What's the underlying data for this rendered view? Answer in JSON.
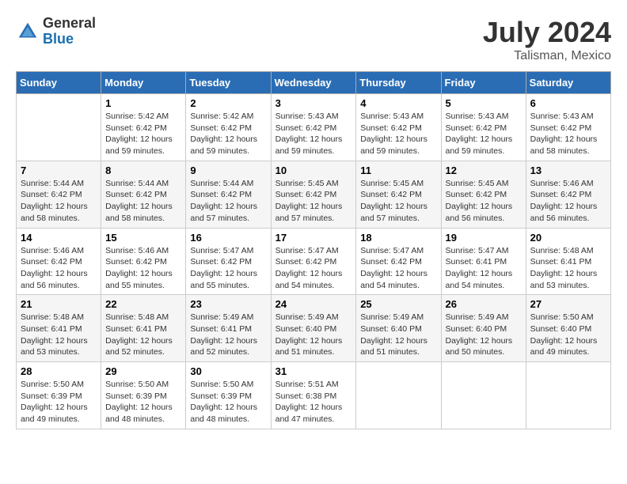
{
  "logo": {
    "general": "General",
    "blue": "Blue"
  },
  "title": {
    "month_year": "July 2024",
    "location": "Talisman, Mexico"
  },
  "days_of_week": [
    "Sunday",
    "Monday",
    "Tuesday",
    "Wednesday",
    "Thursday",
    "Friday",
    "Saturday"
  ],
  "weeks": [
    [
      {
        "day": "",
        "sunrise": "",
        "sunset": "",
        "daylight": ""
      },
      {
        "day": "1",
        "sunrise": "Sunrise: 5:42 AM",
        "sunset": "Sunset: 6:42 PM",
        "daylight": "Daylight: 12 hours and 59 minutes."
      },
      {
        "day": "2",
        "sunrise": "Sunrise: 5:42 AM",
        "sunset": "Sunset: 6:42 PM",
        "daylight": "Daylight: 12 hours and 59 minutes."
      },
      {
        "day": "3",
        "sunrise": "Sunrise: 5:43 AM",
        "sunset": "Sunset: 6:42 PM",
        "daylight": "Daylight: 12 hours and 59 minutes."
      },
      {
        "day": "4",
        "sunrise": "Sunrise: 5:43 AM",
        "sunset": "Sunset: 6:42 PM",
        "daylight": "Daylight: 12 hours and 59 minutes."
      },
      {
        "day": "5",
        "sunrise": "Sunrise: 5:43 AM",
        "sunset": "Sunset: 6:42 PM",
        "daylight": "Daylight: 12 hours and 59 minutes."
      },
      {
        "day": "6",
        "sunrise": "Sunrise: 5:43 AM",
        "sunset": "Sunset: 6:42 PM",
        "daylight": "Daylight: 12 hours and 58 minutes."
      }
    ],
    [
      {
        "day": "7",
        "sunrise": "Sunrise: 5:44 AM",
        "sunset": "Sunset: 6:42 PM",
        "daylight": "Daylight: 12 hours and 58 minutes."
      },
      {
        "day": "8",
        "sunrise": "Sunrise: 5:44 AM",
        "sunset": "Sunset: 6:42 PM",
        "daylight": "Daylight: 12 hours and 58 minutes."
      },
      {
        "day": "9",
        "sunrise": "Sunrise: 5:44 AM",
        "sunset": "Sunset: 6:42 PM",
        "daylight": "Daylight: 12 hours and 57 minutes."
      },
      {
        "day": "10",
        "sunrise": "Sunrise: 5:45 AM",
        "sunset": "Sunset: 6:42 PM",
        "daylight": "Daylight: 12 hours and 57 minutes."
      },
      {
        "day": "11",
        "sunrise": "Sunrise: 5:45 AM",
        "sunset": "Sunset: 6:42 PM",
        "daylight": "Daylight: 12 hours and 57 minutes."
      },
      {
        "day": "12",
        "sunrise": "Sunrise: 5:45 AM",
        "sunset": "Sunset: 6:42 PM",
        "daylight": "Daylight: 12 hours and 56 minutes."
      },
      {
        "day": "13",
        "sunrise": "Sunrise: 5:46 AM",
        "sunset": "Sunset: 6:42 PM",
        "daylight": "Daylight: 12 hours and 56 minutes."
      }
    ],
    [
      {
        "day": "14",
        "sunrise": "Sunrise: 5:46 AM",
        "sunset": "Sunset: 6:42 PM",
        "daylight": "Daylight: 12 hours and 56 minutes."
      },
      {
        "day": "15",
        "sunrise": "Sunrise: 5:46 AM",
        "sunset": "Sunset: 6:42 PM",
        "daylight": "Daylight: 12 hours and 55 minutes."
      },
      {
        "day": "16",
        "sunrise": "Sunrise: 5:47 AM",
        "sunset": "Sunset: 6:42 PM",
        "daylight": "Daylight: 12 hours and 55 minutes."
      },
      {
        "day": "17",
        "sunrise": "Sunrise: 5:47 AM",
        "sunset": "Sunset: 6:42 PM",
        "daylight": "Daylight: 12 hours and 54 minutes."
      },
      {
        "day": "18",
        "sunrise": "Sunrise: 5:47 AM",
        "sunset": "Sunset: 6:42 PM",
        "daylight": "Daylight: 12 hours and 54 minutes."
      },
      {
        "day": "19",
        "sunrise": "Sunrise: 5:47 AM",
        "sunset": "Sunset: 6:41 PM",
        "daylight": "Daylight: 12 hours and 54 minutes."
      },
      {
        "day": "20",
        "sunrise": "Sunrise: 5:48 AM",
        "sunset": "Sunset: 6:41 PM",
        "daylight": "Daylight: 12 hours and 53 minutes."
      }
    ],
    [
      {
        "day": "21",
        "sunrise": "Sunrise: 5:48 AM",
        "sunset": "Sunset: 6:41 PM",
        "daylight": "Daylight: 12 hours and 53 minutes."
      },
      {
        "day": "22",
        "sunrise": "Sunrise: 5:48 AM",
        "sunset": "Sunset: 6:41 PM",
        "daylight": "Daylight: 12 hours and 52 minutes."
      },
      {
        "day": "23",
        "sunrise": "Sunrise: 5:49 AM",
        "sunset": "Sunset: 6:41 PM",
        "daylight": "Daylight: 12 hours and 52 minutes."
      },
      {
        "day": "24",
        "sunrise": "Sunrise: 5:49 AM",
        "sunset": "Sunset: 6:40 PM",
        "daylight": "Daylight: 12 hours and 51 minutes."
      },
      {
        "day": "25",
        "sunrise": "Sunrise: 5:49 AM",
        "sunset": "Sunset: 6:40 PM",
        "daylight": "Daylight: 12 hours and 51 minutes."
      },
      {
        "day": "26",
        "sunrise": "Sunrise: 5:49 AM",
        "sunset": "Sunset: 6:40 PM",
        "daylight": "Daylight: 12 hours and 50 minutes."
      },
      {
        "day": "27",
        "sunrise": "Sunrise: 5:50 AM",
        "sunset": "Sunset: 6:40 PM",
        "daylight": "Daylight: 12 hours and 49 minutes."
      }
    ],
    [
      {
        "day": "28",
        "sunrise": "Sunrise: 5:50 AM",
        "sunset": "Sunset: 6:39 PM",
        "daylight": "Daylight: 12 hours and 49 minutes."
      },
      {
        "day": "29",
        "sunrise": "Sunrise: 5:50 AM",
        "sunset": "Sunset: 6:39 PM",
        "daylight": "Daylight: 12 hours and 48 minutes."
      },
      {
        "day": "30",
        "sunrise": "Sunrise: 5:50 AM",
        "sunset": "Sunset: 6:39 PM",
        "daylight": "Daylight: 12 hours and 48 minutes."
      },
      {
        "day": "31",
        "sunrise": "Sunrise: 5:51 AM",
        "sunset": "Sunset: 6:38 PM",
        "daylight": "Daylight: 12 hours and 47 minutes."
      },
      {
        "day": "",
        "sunrise": "",
        "sunset": "",
        "daylight": ""
      },
      {
        "day": "",
        "sunrise": "",
        "sunset": "",
        "daylight": ""
      },
      {
        "day": "",
        "sunrise": "",
        "sunset": "",
        "daylight": ""
      }
    ]
  ]
}
